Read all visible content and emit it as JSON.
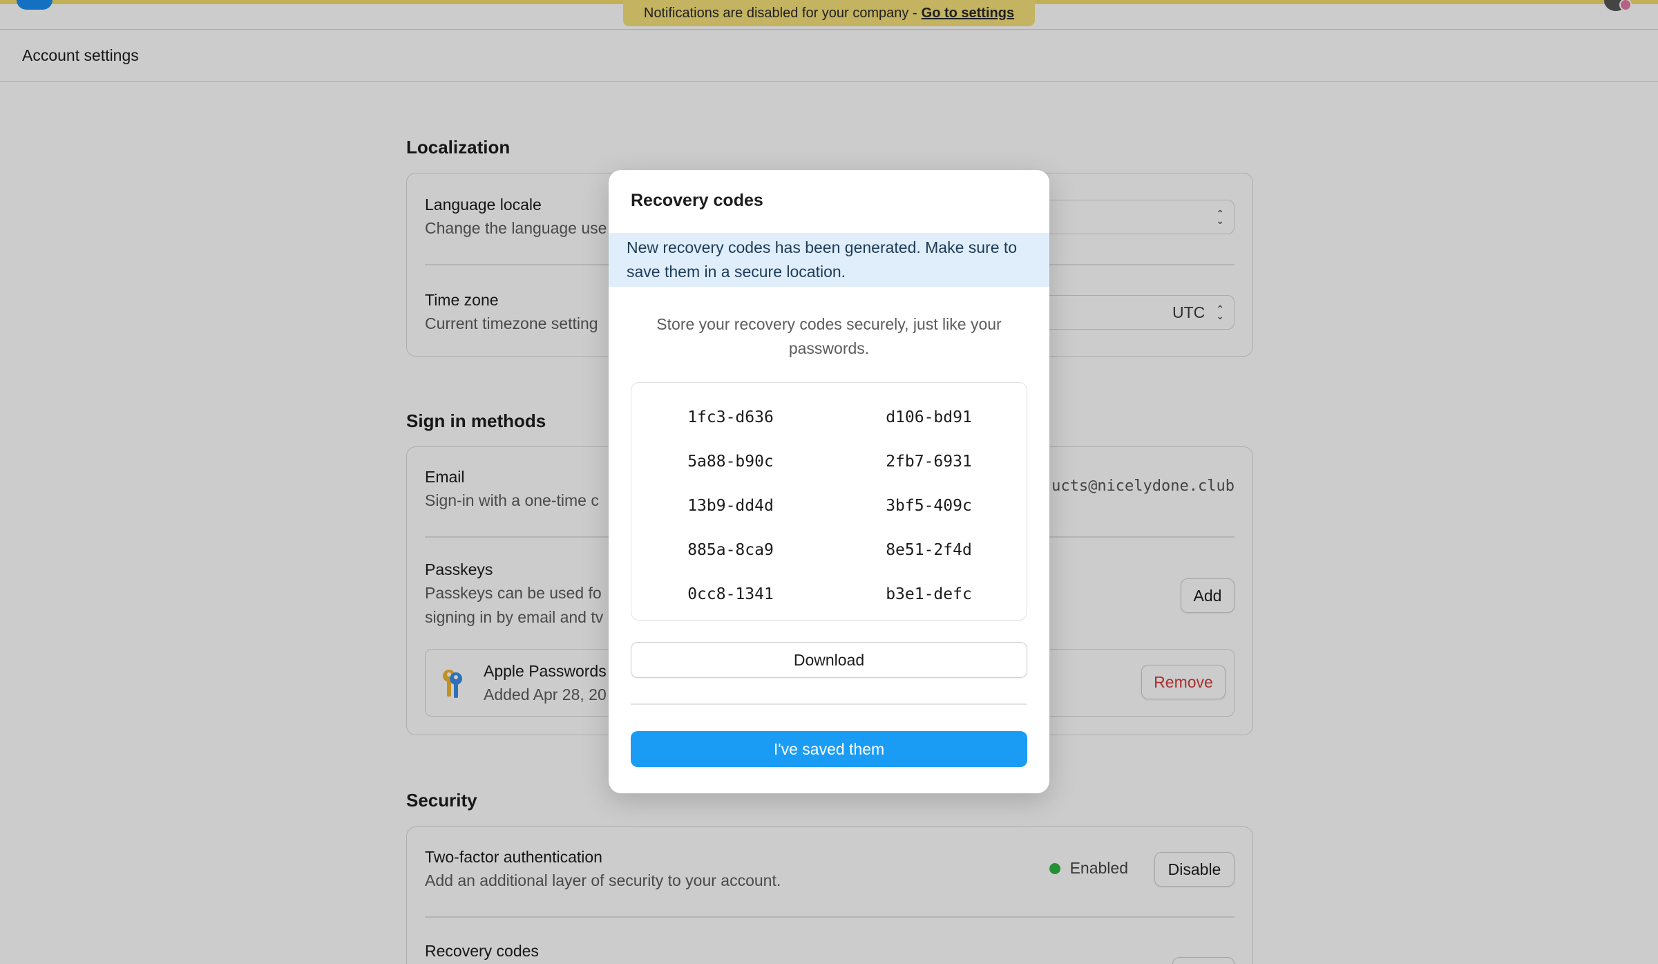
{
  "notice": {
    "text": "Notifications are disabled for your company -",
    "link": "Go to settings"
  },
  "header": {
    "title": "Account settings"
  },
  "localization": {
    "title": "Localization",
    "language": {
      "title": "Language locale",
      "desc": "Change the language use"
    },
    "timezone": {
      "title": "Time zone",
      "desc": "Current timezone setting",
      "value": "UTC"
    }
  },
  "signin": {
    "title": "Sign in methods",
    "email": {
      "title": "Email",
      "desc": "Sign-in with a one-time c",
      "value": "ucts@nicelydone.club"
    },
    "passkeys": {
      "title": "Passkeys",
      "desc_line1": "Passkeys can be used fo",
      "desc_line2": "signing in by email and tv",
      "add_label": "Add",
      "item_name": "Apple Passwords",
      "item_added": "Added Apr 28, 20",
      "remove_label": "Remove"
    }
  },
  "security": {
    "title": "Security",
    "twofa": {
      "title": "Two-factor authentication",
      "desc": "Add an additional layer of security to your account.",
      "status": "Enabled",
      "disable_label": "Disable"
    },
    "recovery": {
      "title": "Recovery codes"
    }
  },
  "modal": {
    "title": "Recovery codes",
    "alert": "New recovery codes has been generated. Make sure to save them in a secure location.",
    "intro": "Store your recovery codes securely, just like your passwords.",
    "codes": [
      "1fc3-d636",
      "d106-bd91",
      "5a88-b90c",
      "2fb7-6931",
      "13b9-dd4d",
      "3bf5-409c",
      "885a-8ca9",
      "8e51-2f4d",
      "0cc8-1341",
      "b3e1-defc"
    ],
    "download_label": "Download",
    "confirm_label": "I've saved them"
  },
  "colors": {
    "accent": "#1a9cf5",
    "banner": "#f5e079",
    "alert_bg": "#dfeefa",
    "status_enabled": "#2fb344",
    "danger": "#d93a3a"
  }
}
